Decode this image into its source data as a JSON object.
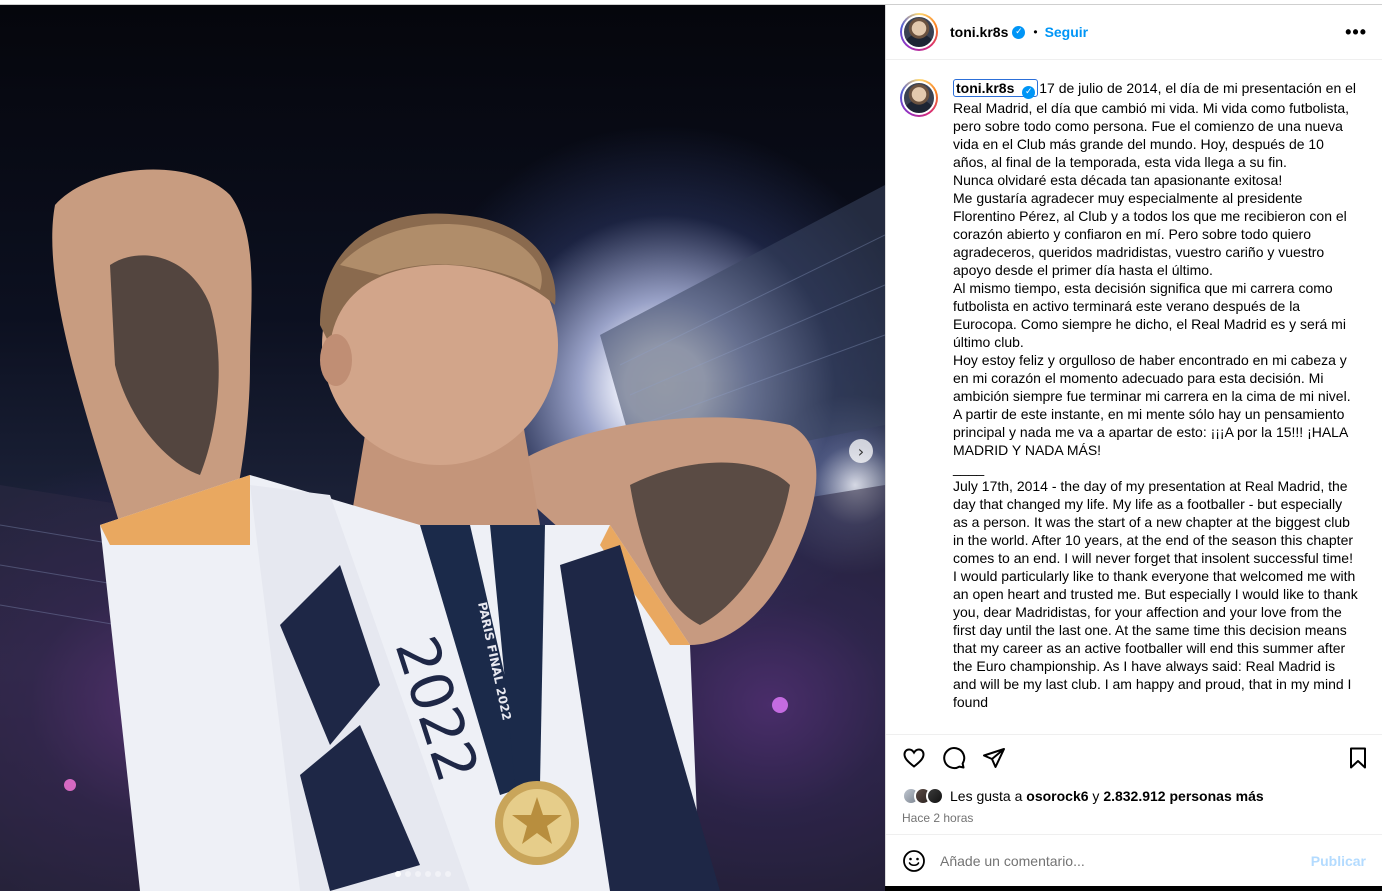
{
  "post": {
    "username": "toni.kr8s",
    "separator": "•",
    "follow_label": "Seguir",
    "more_label": "•••",
    "verified_glyph": "✓",
    "caption": "17 de julio de 2014, el día de mi presentación en el Real Madrid, el día que cambió mi vida. Mi vida como futbolista, pero sobre todo como persona. Fue el comienzo de una nueva vida en el Club más grande del mundo. Hoy, después de 10 años, al final de la temporada, esta vida llega a su fin.\nNunca olvidaré esta década tan apasionante exitosa!\nMe gustaría agradecer muy especialmente al presidente Florentino Pérez, al Club y a todos los que me recibieron con el corazón abierto y confiaron en mí. Pero sobre todo quiero agradeceros, queridos madridistas, vuestro cariño y vuestro apoyo desde el primer día hasta el último.\nAl mismo tiempo, esta decisión significa que mi carrera como futbolista en activo terminará este verano después de la Eurocopa. Como siempre he dicho, el Real Madrid es y será mi último club.\nHoy estoy feliz y orgulloso de haber encontrado en mi cabeza y en mi corazón el momento adecuado para esta decisión. Mi ambición siempre fue terminar mi carrera en la cima de mi nivel. A partir de este instante, en mi mente sólo hay un pensamiento principal y nada me va a apartar de esto: ¡¡¡A por la 15!!! ¡HALA MADRID Y NADA MÁS!\n____\nJuly 17th, 2014 - the day of my presentation at Real Madrid, the day that changed my life. My life as a footballer - but especially as a person. It was the start of a new chapter at the biggest club in the world. After 10 years, at the end of the season this chapter comes to an end. I will never forget that insolent successful time! I would particularly like to thank everyone that welcomed me with an open heart and trusted me. But especially I would like to thank you, dear Madridistas, for your affection and your love from the first day until the last one. At the same time this decision means that my career as an active footballer will end this summer after the Euro championship. As I have always said: Real Madrid is and will be my last club. I am happy and proud, that in my mind I found",
    "likes_prefix": "Les gusta a",
    "likes_user": "osorock6",
    "likes_connector": "y",
    "likes_count": "2.832.912 personas más",
    "time_ago": "Hace 2 horas",
    "comment_placeholder": "Añade un comentario...",
    "publish_label": "Publicar"
  },
  "media": {
    "next_glyph": "›",
    "slide_count": 6,
    "active_slide": 1,
    "scarf_text": "2022",
    "medal_ribbon_text": "PARIS FINAL 2022"
  },
  "icons": {
    "like": "heart-icon",
    "comment": "comment-icon",
    "share": "share-icon",
    "save": "bookmark-icon",
    "emoji": "emoji-icon"
  },
  "colors": {
    "accent": "#0095f6",
    "publish_disabled": "#b3dbff",
    "muted": "#737373"
  }
}
